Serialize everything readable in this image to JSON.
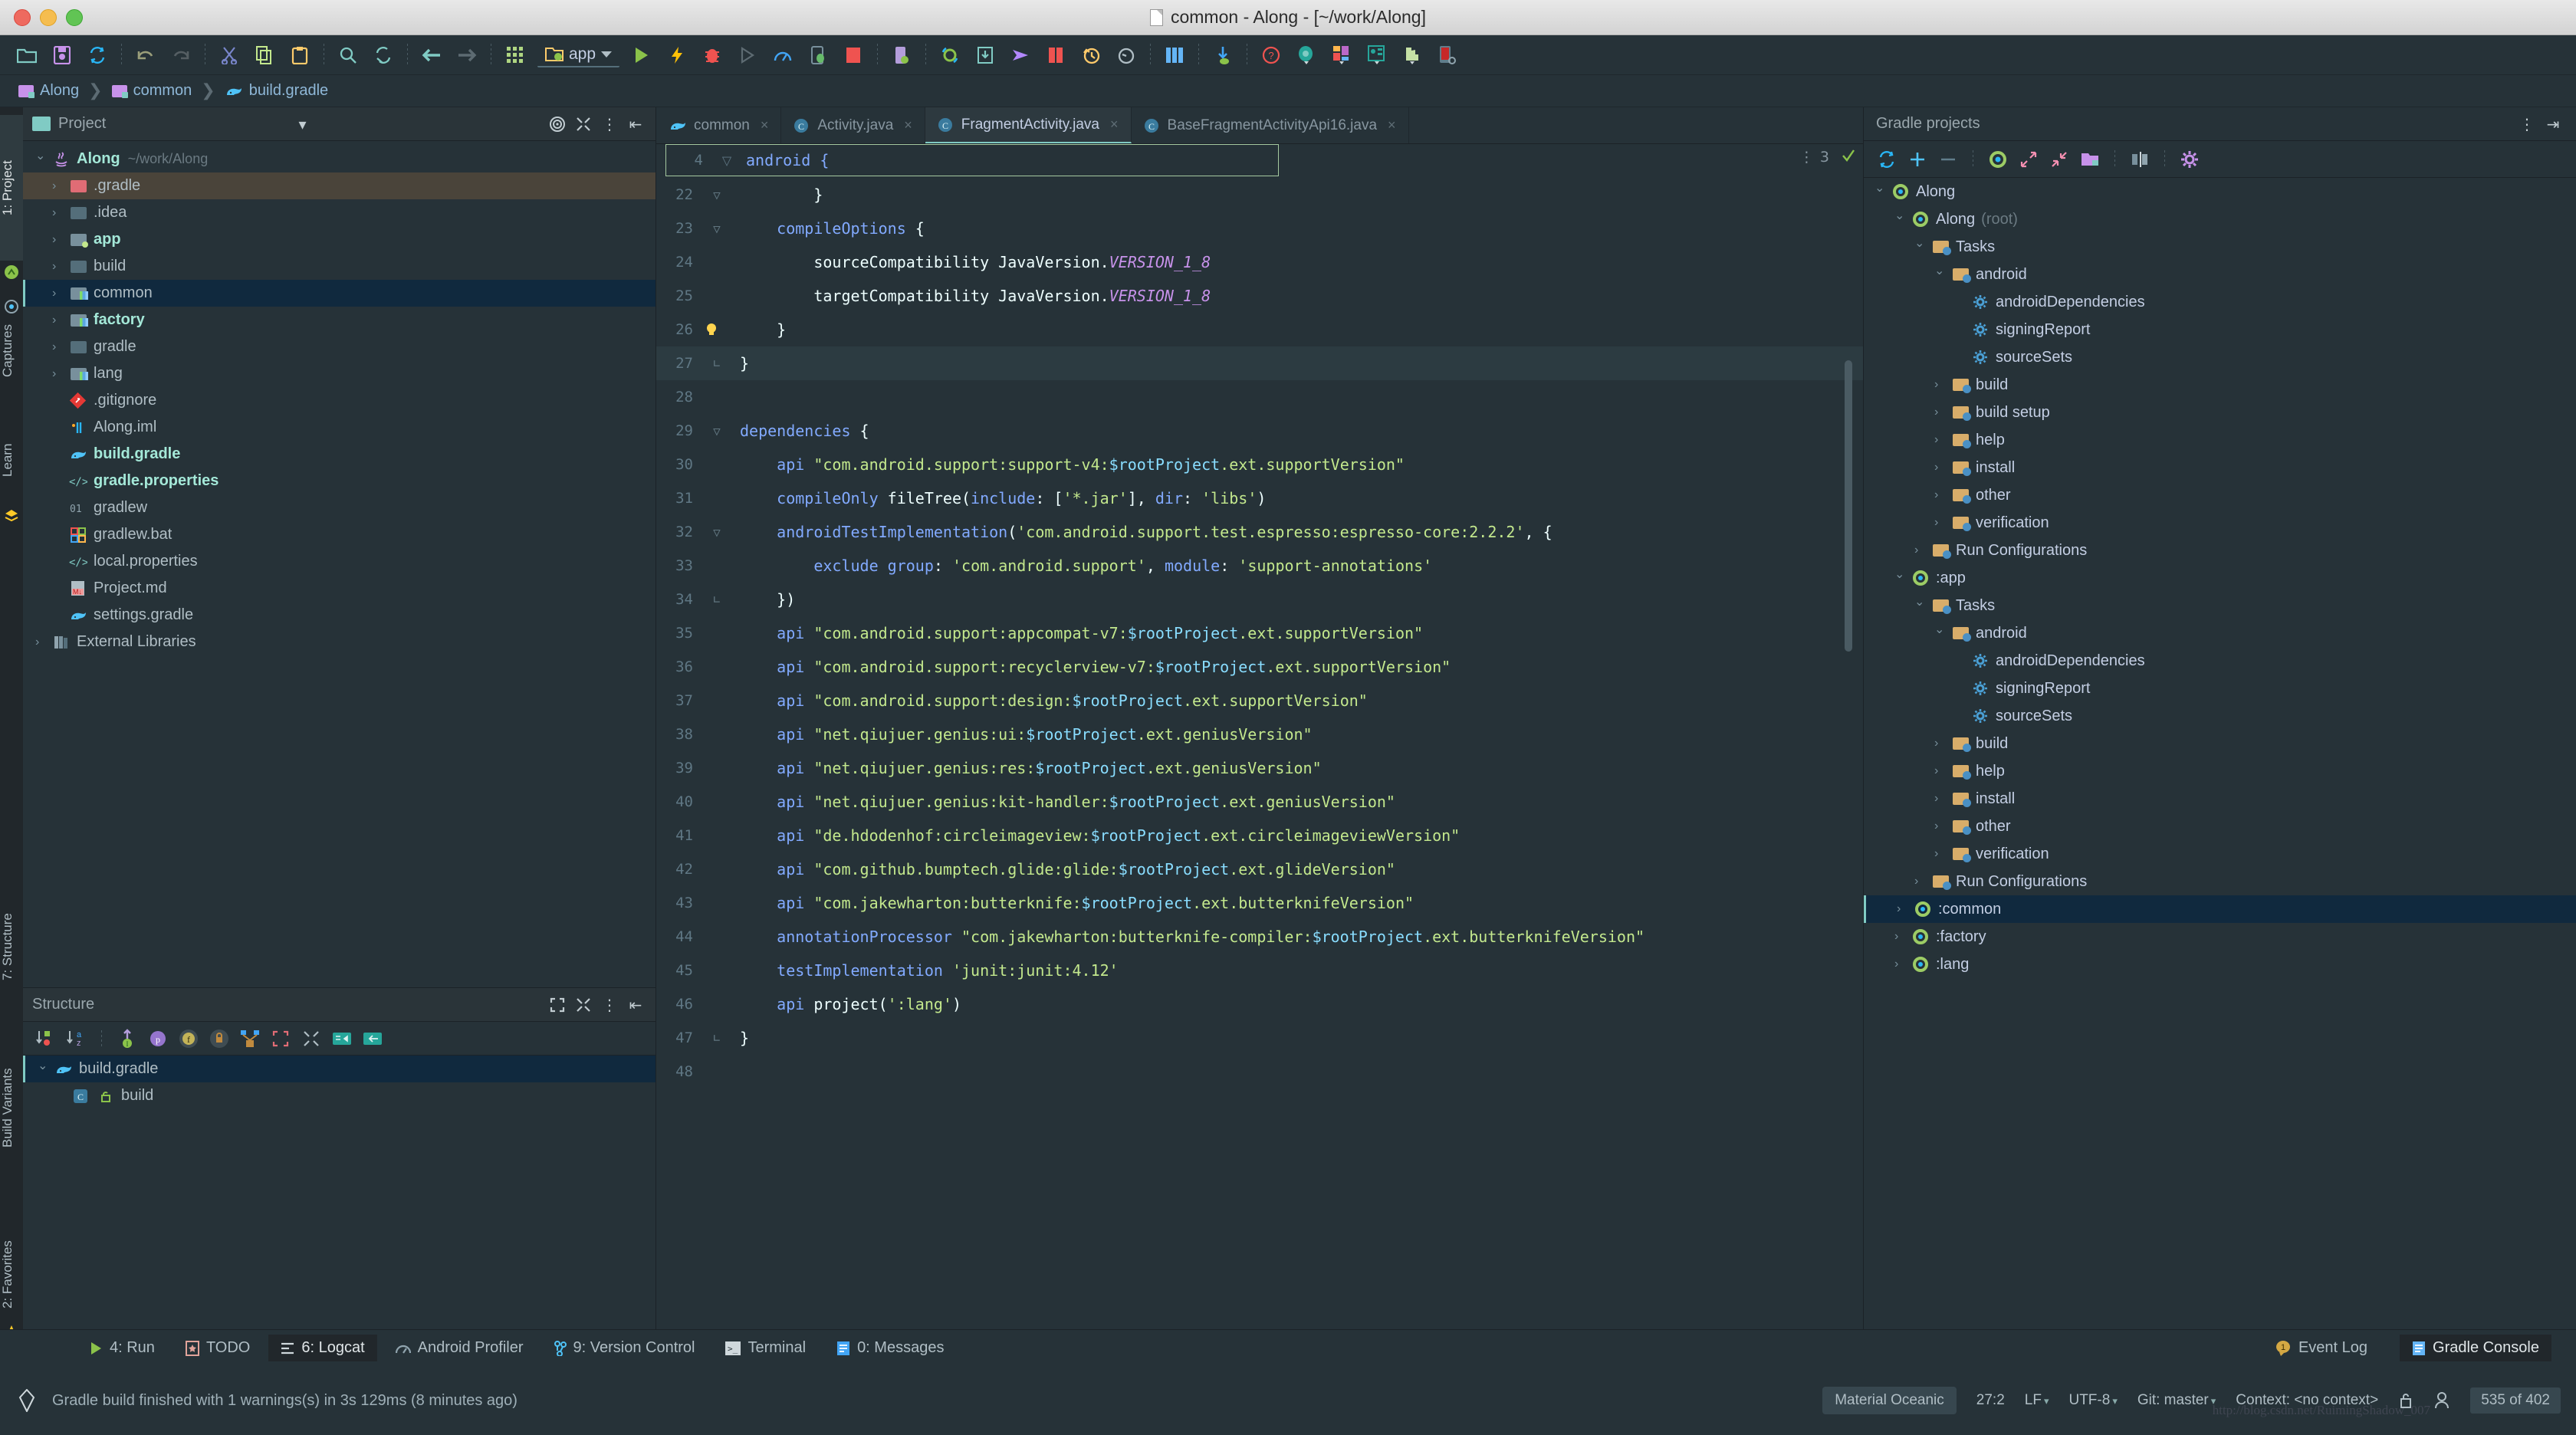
{
  "window": {
    "title": "common - Along - [~/work/Along]",
    "doc_icon": "document-icon"
  },
  "toolbar": {
    "icons": [
      "open-folder-icon",
      "save-all-icon",
      "sync-icon",
      "undo-icon",
      "redo-icon",
      "cut-icon",
      "copy-icon",
      "paste-icon",
      "search-icon",
      "replace-icon",
      "back-arrow-icon",
      "forward-arrow-icon",
      "grid-icon"
    ],
    "module_selector": "app",
    "run_icons": [
      "run-icon",
      "apply-changes-icon",
      "debug-icon",
      "run-step-icon",
      "profiler-icon",
      "attach-debugger-icon",
      "stop-icon",
      "avd-manager-icon",
      "sync-gradle-icon",
      "sdk-download-icon",
      "send-icon",
      "layout-inspector-icon",
      "history-icon",
      "revert-icon",
      "grid2-icon",
      "device-download-icon",
      "help-icon",
      "gradle-icon",
      "layout-icon",
      "resource-icon",
      "plugin-icon",
      "device-icon"
    ]
  },
  "breadcrumb": {
    "items": [
      {
        "label": "Along",
        "icon": "folder-icon"
      },
      {
        "label": "common",
        "icon": "folder-icon"
      },
      {
        "label": "build.gradle",
        "icon": "gradle-icon"
      }
    ]
  },
  "left_strip": {
    "tabs": [
      "1: Project",
      "Captures",
      "Learn"
    ],
    "bottom_tabs": [
      "7: Structure",
      "Build Variants",
      "2: Favorites"
    ]
  },
  "project_panel": {
    "title": "Project",
    "toolbar_icons": [
      "target-icon",
      "collapse-all-icon",
      "more-options-icon",
      "hide-panel-icon"
    ],
    "tree": [
      {
        "label": "Along",
        "path": "~/work/Along",
        "icon": "java-icon",
        "arrow": "down",
        "indent": 0,
        "state": "normal"
      },
      {
        "label": ".gradle",
        "icon": "folder-red-icon",
        "arrow": "right",
        "indent": 1,
        "state": "brown"
      },
      {
        "label": ".idea",
        "icon": "folder-grey-icon",
        "arrow": "right",
        "indent": 1,
        "state": "normal"
      },
      {
        "label": "app",
        "icon": "module-dot-icon",
        "arrow": "right",
        "indent": 1,
        "state": "normal"
      },
      {
        "label": "build",
        "icon": "folder-grey-icon",
        "arrow": "right",
        "indent": 1,
        "state": "normal"
      },
      {
        "label": "common",
        "icon": "module-icon",
        "arrow": "right",
        "indent": 1,
        "state": "selected"
      },
      {
        "label": "factory",
        "icon": "module-icon",
        "arrow": "right",
        "indent": 1,
        "state": "normal"
      },
      {
        "label": "gradle",
        "icon": "folder-grey-icon",
        "arrow": "right",
        "indent": 1,
        "state": "normal"
      },
      {
        "label": "lang",
        "icon": "module-icon",
        "arrow": "right",
        "indent": 1,
        "state": "normal"
      },
      {
        "label": ".gitignore",
        "icon": "git-icon",
        "arrow": "none",
        "indent": 1,
        "state": "normal"
      },
      {
        "label": "Along.iml",
        "icon": "iml-icon",
        "arrow": "none",
        "indent": 1,
        "state": "normal"
      },
      {
        "label": "build.gradle",
        "icon": "gradle-icon",
        "arrow": "none",
        "indent": 1,
        "state": "normal"
      },
      {
        "label": "gradle.properties",
        "icon": "properties-icon",
        "arrow": "none",
        "indent": 1,
        "state": "normal"
      },
      {
        "label": "gradlew",
        "icon": "shell-icon",
        "arrow": "none",
        "indent": 1,
        "state": "normal"
      },
      {
        "label": "gradlew.bat",
        "icon": "bat-icon",
        "arrow": "none",
        "indent": 1,
        "state": "normal"
      },
      {
        "label": "local.properties",
        "icon": "properties-icon",
        "arrow": "none",
        "indent": 1,
        "state": "normal"
      },
      {
        "label": "Project.md",
        "icon": "markdown-icon",
        "arrow": "none",
        "indent": 1,
        "state": "normal"
      },
      {
        "label": "settings.gradle",
        "icon": "gradle-icon",
        "arrow": "none",
        "indent": 1,
        "state": "normal"
      },
      {
        "label": "External Libraries",
        "icon": "library-icon",
        "arrow": "right",
        "indent": 0,
        "state": "normal"
      }
    ]
  },
  "structure_panel": {
    "title": "Structure",
    "header_icons": [
      "expand-icon",
      "collapse-all-icon",
      "more-options-icon",
      "hide-panel-icon"
    ],
    "toolbar_icons": [
      "sort-by-visibility-icon",
      "sort-alphabetically-icon",
      "show-inherited-icon",
      "show-properties-icon",
      "show-fields-icon",
      "show-non-public-icon",
      "show-anonymous-icon",
      "expand-all-icon",
      "collapse-all-icon",
      "autoscroll-to-source-icon",
      "autoscroll-from-source-icon"
    ],
    "tree": [
      {
        "label": "build.gradle",
        "icon": "gradle-icon",
        "arrow": "down",
        "indent": 0,
        "state": "selected"
      },
      {
        "label": "build",
        "icon": "class-icon",
        "arrow": "none",
        "indent": 1,
        "state": "normal"
      }
    ]
  },
  "editor": {
    "tabs": [
      {
        "label": "common",
        "icon": "gradle-icon",
        "active": false,
        "closable": true
      },
      {
        "label": "Activity.java",
        "icon": "class-icon",
        "active": false,
        "closable": true
      },
      {
        "label": "FragmentActivity.java",
        "icon": "class-icon",
        "active": true,
        "closable": true
      },
      {
        "label": "BaseFragmentActivityApi16.java",
        "icon": "class-icon",
        "active": false,
        "closable": true
      }
    ],
    "tab_counter": "3",
    "sticky_header": {
      "line": "4",
      "text": "android {"
    },
    "lines": [
      {
        "no": "22",
        "fold": "minus",
        "change": "none",
        "html": "        <span class=\"d\">}</span>"
      },
      {
        "no": "23",
        "fold": "minus",
        "change": "none",
        "html": "    <span class=\"k\">compileOptions</span> <span class=\"d\">{</span>"
      },
      {
        "no": "24",
        "fold": "none",
        "change": "none",
        "html": "        <span class=\"d\">sourceCompatibility</span> <span class=\"d\">JavaVersion.</span><span class=\"v\">VERSION_1_8</span>"
      },
      {
        "no": "25",
        "fold": "none",
        "change": "none",
        "html": "        <span class=\"d\">targetCompatibility</span> <span class=\"d\">JavaVersion.</span><span class=\"v\">VERSION_1_8</span>"
      },
      {
        "no": "26",
        "fold": "bulb",
        "change": "none",
        "html": "    <span class=\"d\">}</span>"
      },
      {
        "no": "27",
        "fold": "end",
        "change": "none",
        "html": "<span class=\"d\">}</span>"
      },
      {
        "no": "28",
        "fold": "none",
        "change": "none",
        "html": ""
      },
      {
        "no": "29",
        "fold": "minus",
        "change": "green",
        "html": "<span class=\"k\">dependencies</span> <span class=\"d\">{</span>"
      },
      {
        "no": "30",
        "fold": "none",
        "change": "green",
        "html": "    <span class=\"k\">api</span> <span class=\"s\">\"com.android.support:support-v4:</span><span class=\"p\">$rootProject</span><span class=\"s\">.ext.supportVersion\"</span>"
      },
      {
        "no": "31",
        "fold": "none",
        "change": "green",
        "html": "    <span class=\"k\">compileOnly</span> <span class=\"d\">fileTree(</span><span class=\"k\">include</span><span class=\"d\">: [</span><span class=\"s\">'*.jar'</span><span class=\"d\">], </span><span class=\"k\">dir</span><span class=\"d\">: </span><span class=\"s\">'libs'</span><span class=\"d\">)</span>"
      },
      {
        "no": "32",
        "fold": "minus",
        "change": "green",
        "html": "    <span class=\"k\">androidTestImplementation</span><span class=\"d\">(</span><span class=\"s\">'com.android.support.test.espresso:espresso-core:2.2.2'</span><span class=\"d\">, {</span>"
      },
      {
        "no": "33",
        "fold": "none",
        "change": "green",
        "html": "        <span class=\"k\">exclude</span> <span class=\"k\">group</span><span class=\"d\">: </span><span class=\"s\">'com.android.support'</span><span class=\"d\">, </span><span class=\"k\">module</span><span class=\"d\">: </span><span class=\"s\">'support-annotations'</span>"
      },
      {
        "no": "34",
        "fold": "end",
        "change": "green",
        "html": "    <span class=\"d\">})</span>"
      },
      {
        "no": "35",
        "fold": "none",
        "change": "green",
        "html": "    <span class=\"k\">api</span> <span class=\"s\">\"com.android.support:appcompat-v7:</span><span class=\"p\">$rootProject</span><span class=\"s\">.ext.supportVersion\"</span>"
      },
      {
        "no": "36",
        "fold": "none",
        "change": "green",
        "html": "    <span class=\"k\">api</span> <span class=\"s\">\"com.android.support:recyclerview-v7:</span><span class=\"p\">$rootProject</span><span class=\"s\">.ext.supportVersion\"</span>"
      },
      {
        "no": "37",
        "fold": "none",
        "change": "green",
        "html": "    <span class=\"k\">api</span> <span class=\"s\">\"com.android.support:design:</span><span class=\"p\">$rootProject</span><span class=\"s\">.ext.supportVersion\"</span>"
      },
      {
        "no": "38",
        "fold": "none",
        "change": "green",
        "html": "    <span class=\"k\">api</span> <span class=\"s\">\"net.qiujuer.genius:ui:</span><span class=\"p\">$rootProject</span><span class=\"s\">.ext.geniusVersion\"</span>"
      },
      {
        "no": "39",
        "fold": "none",
        "change": "green",
        "html": "    <span class=\"k\">api</span> <span class=\"s\">\"net.qiujuer.genius:res:</span><span class=\"p\">$rootProject</span><span class=\"s\">.ext.geniusVersion\"</span>"
      },
      {
        "no": "40",
        "fold": "none",
        "change": "green",
        "html": "    <span class=\"k\">api</span> <span class=\"s\">\"net.qiujuer.genius:kit-handler:</span><span class=\"p\">$rootProject</span><span class=\"s\">.ext.geniusVersion\"</span>"
      },
      {
        "no": "41",
        "fold": "none",
        "change": "green",
        "html": "    <span class=\"k\">api</span> <span class=\"s\">\"de.hdodenhof:circleimageview:</span><span class=\"p\">$rootProject</span><span class=\"s\">.ext.circleimageviewVersion\"</span>"
      },
      {
        "no": "42",
        "fold": "none",
        "change": "green",
        "html": "    <span class=\"k\">api</span> <span class=\"s\">\"com.github.bumptech.glide:glide:</span><span class=\"p\">$rootProject</span><span class=\"s\">.ext.glideVersion\"</span>"
      },
      {
        "no": "43",
        "fold": "none",
        "change": "green",
        "html": "    <span class=\"k\">api</span> <span class=\"s\">\"com.jakewharton:butterknife:</span><span class=\"p\">$rootProject</span><span class=\"s\">.ext.butterknifeVersion\"</span>"
      },
      {
        "no": "44",
        "fold": "none",
        "change": "green",
        "html": "    <span class=\"k\">annotationProcessor</span> <span class=\"s\">\"com.jakewharton:butterknife-compiler:</span><span class=\"p\">$rootProject</span><span class=\"s\">.ext.butterknifeVersion\"</span>"
      },
      {
        "no": "45",
        "fold": "none",
        "change": "green",
        "html": "    <span class=\"k\">testImplementation</span> <span class=\"s\">'junit:junit:4.12'</span>"
      },
      {
        "no": "46",
        "fold": "none",
        "change": "green",
        "html": "    <span class=\"k\">api</span> <span class=\"d\">project(</span><span class=\"s\">':lang'</span><span class=\"d\">)</span>"
      },
      {
        "no": "47",
        "fold": "end",
        "change": "none",
        "html": "<span class=\"d\">}</span>"
      },
      {
        "no": "48",
        "fold": "none",
        "change": "none",
        "html": ""
      }
    ]
  },
  "gradle_panel": {
    "title": "Gradle projects",
    "header_icons": [
      "more-options-icon",
      "hide-panel-icon"
    ],
    "toolbar_icons": [
      "refresh-icon",
      "add-icon",
      "remove-icon",
      "run-task-icon",
      "expand-all-icon",
      "collapse-all-icon",
      "open-module-icon",
      "toggle-offline-icon",
      "settings-icon"
    ],
    "tree": [
      {
        "label": "Along",
        "icon": "gradle-project-icon",
        "arrow": "down",
        "indent": 0,
        "state": "normal"
      },
      {
        "label": "Along",
        "suffix": "(root)",
        "icon": "gradle-project-icon",
        "arrow": "down",
        "indent": 1,
        "state": "normal"
      },
      {
        "label": "Tasks",
        "icon": "task-folder-icon",
        "arrow": "down",
        "indent": 2,
        "state": "normal"
      },
      {
        "label": "android",
        "icon": "task-folder-icon",
        "arrow": "down",
        "indent": 3,
        "state": "normal"
      },
      {
        "label": "androidDependencies",
        "icon": "gear-icon",
        "arrow": "none",
        "indent": 4,
        "state": "normal"
      },
      {
        "label": "signingReport",
        "icon": "gear-icon",
        "arrow": "none",
        "indent": 4,
        "state": "normal"
      },
      {
        "label": "sourceSets",
        "icon": "gear-icon",
        "arrow": "none",
        "indent": 4,
        "state": "normal"
      },
      {
        "label": "build",
        "icon": "task-folder-icon",
        "arrow": "right",
        "indent": 3,
        "state": "normal"
      },
      {
        "label": "build setup",
        "icon": "task-folder-icon",
        "arrow": "right",
        "indent": 3,
        "state": "normal"
      },
      {
        "label": "help",
        "icon": "task-folder-icon",
        "arrow": "right",
        "indent": 3,
        "state": "normal"
      },
      {
        "label": "install",
        "icon": "task-folder-icon",
        "arrow": "right",
        "indent": 3,
        "state": "normal"
      },
      {
        "label": "other",
        "icon": "task-folder-icon",
        "arrow": "right",
        "indent": 3,
        "state": "normal"
      },
      {
        "label": "verification",
        "icon": "task-folder-icon",
        "arrow": "right",
        "indent": 3,
        "state": "normal"
      },
      {
        "label": "Run Configurations",
        "icon": "task-folder-icon",
        "arrow": "right",
        "indent": 2,
        "state": "normal"
      },
      {
        "label": ":app",
        "icon": "gradle-project-icon",
        "arrow": "down",
        "indent": 1,
        "state": "normal"
      },
      {
        "label": "Tasks",
        "icon": "task-folder-icon",
        "arrow": "down",
        "indent": 2,
        "state": "normal"
      },
      {
        "label": "android",
        "icon": "task-folder-icon",
        "arrow": "down",
        "indent": 3,
        "state": "normal"
      },
      {
        "label": "androidDependencies",
        "icon": "gear-icon",
        "arrow": "none",
        "indent": 4,
        "state": "normal"
      },
      {
        "label": "signingReport",
        "icon": "gear-icon",
        "arrow": "none",
        "indent": 4,
        "state": "normal"
      },
      {
        "label": "sourceSets",
        "icon": "gear-icon",
        "arrow": "none",
        "indent": 4,
        "state": "normal"
      },
      {
        "label": "build",
        "icon": "task-folder-icon",
        "arrow": "right",
        "indent": 3,
        "state": "normal"
      },
      {
        "label": "help",
        "icon": "task-folder-icon",
        "arrow": "right",
        "indent": 3,
        "state": "normal"
      },
      {
        "label": "install",
        "icon": "task-folder-icon",
        "arrow": "right",
        "indent": 3,
        "state": "normal"
      },
      {
        "label": "other",
        "icon": "task-folder-icon",
        "arrow": "right",
        "indent": 3,
        "state": "normal"
      },
      {
        "label": "verification",
        "icon": "task-folder-icon",
        "arrow": "right",
        "indent": 3,
        "state": "normal"
      },
      {
        "label": "Run Configurations",
        "icon": "task-folder-icon",
        "arrow": "right",
        "indent": 2,
        "state": "normal"
      },
      {
        "label": ":common",
        "icon": "gradle-project-icon",
        "arrow": "right",
        "indent": 1,
        "state": "selected"
      },
      {
        "label": ":factory",
        "icon": "gradle-project-icon",
        "arrow": "right",
        "indent": 1,
        "state": "normal"
      },
      {
        "label": ":lang",
        "icon": "gradle-project-icon",
        "arrow": "right",
        "indent": 1,
        "state": "normal"
      }
    ]
  },
  "bottom_bar": {
    "items": [
      {
        "label": "4: Run",
        "icon": "run-icon",
        "active": false
      },
      {
        "label": "TODO",
        "icon": "todo-icon",
        "active": false
      },
      {
        "label": "6: Logcat",
        "icon": "logcat-icon",
        "active": true
      },
      {
        "label": "Android Profiler",
        "icon": "profiler-icon",
        "active": false
      },
      {
        "label": "9: Version Control",
        "icon": "vcs-icon",
        "active": false
      },
      {
        "label": "Terminal",
        "icon": "terminal-icon",
        "active": false
      },
      {
        "label": "0: Messages",
        "icon": "messages-icon",
        "active": false
      }
    ],
    "right_items": [
      {
        "label": "Event Log",
        "icon": "event-log-icon",
        "badge": "1",
        "active": false
      },
      {
        "label": "Gradle Console",
        "icon": "gradle-console-icon",
        "active": true
      }
    ]
  },
  "status_bar": {
    "message": "Gradle build finished with 1 warnings(s) in 3s 129ms (8 minutes ago)",
    "theme": "Material Oceanic",
    "caret": "27:2",
    "line_sep": "LF",
    "encoding": "UTF-8",
    "branch": "Git: master",
    "context": "Context: <no context>",
    "memory": "535 of 402",
    "icons": [
      "lock-icon",
      "inspector-icon"
    ],
    "watermark": "http://blog.csdn.net/RuimingShadow_007"
  }
}
